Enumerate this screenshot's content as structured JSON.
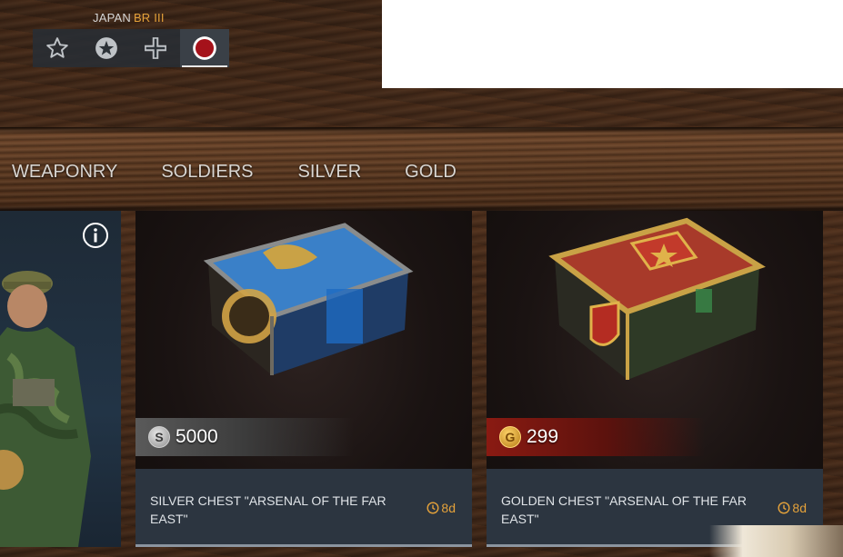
{
  "nation": {
    "name": "JAPAN",
    "br": "BR III",
    "buttons": [
      {
        "icon": "star-outline-icon",
        "active": false
      },
      {
        "icon": "star-circle-icon",
        "active": false
      },
      {
        "icon": "iron-cross-icon",
        "active": false
      },
      {
        "icon": "japan-roundel-icon",
        "active": true
      }
    ]
  },
  "tabs": [
    "WEAPONRY",
    "SOLDIERS",
    "SILVER",
    "GOLD"
  ],
  "cards": [
    {
      "title": "SILVER CHEST \"ARSENAL OF THE FAR EAST\"",
      "price": "5000",
      "currency": "silver",
      "timer": "8d"
    },
    {
      "title": "GOLDEN CHEST \"ARSENAL OF THE FAR EAST\"",
      "price": "299",
      "currency": "gold",
      "timer": "8d"
    }
  ],
  "colors": {
    "accent_orange": "#e5a23a",
    "card_footer": "#2c3540"
  }
}
